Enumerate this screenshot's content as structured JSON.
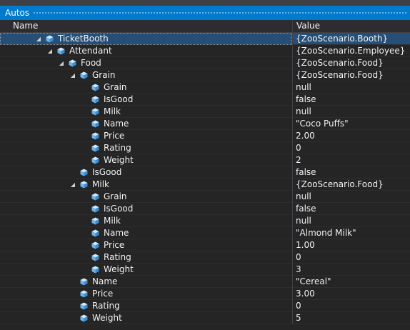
{
  "window": {
    "title": "Autos"
  },
  "columns": {
    "name": "Name",
    "value": "Value"
  },
  "colors": {
    "title_bar": "#007acc",
    "background": "#252526",
    "header": "#2d2d30",
    "selection": "#264f78",
    "cube_icon": "#6fb3e6"
  },
  "rows": [
    {
      "name": "TicketBooth",
      "value": "{ZooScenario.Booth}",
      "depth": 0,
      "expandable": true,
      "expanded": true,
      "icon": "object-cube-icon",
      "selected": true
    },
    {
      "name": "Attendant",
      "value": "{ZooScenario.Employee}",
      "depth": 1,
      "expandable": true,
      "expanded": true,
      "icon": "object-cube-icon"
    },
    {
      "name": "Food",
      "value": "{ZooScenario.Food}",
      "depth": 2,
      "expandable": true,
      "expanded": true,
      "icon": "object-cube-icon"
    },
    {
      "name": "Grain",
      "value": "{ZooScenario.Food}",
      "depth": 3,
      "expandable": true,
      "expanded": true,
      "icon": "object-cube-icon"
    },
    {
      "name": "Grain",
      "value": "null",
      "depth": 4,
      "expandable": false,
      "icon": "property-cube-icon"
    },
    {
      "name": "IsGood",
      "value": "false",
      "depth": 4,
      "expandable": false,
      "icon": "property-cube-icon"
    },
    {
      "name": "Milk",
      "value": "null",
      "depth": 4,
      "expandable": false,
      "icon": "property-cube-icon"
    },
    {
      "name": "Name",
      "value": "\"Coco Puffs\"",
      "depth": 4,
      "expandable": false,
      "icon": "property-cube-icon"
    },
    {
      "name": "Price",
      "value": "2.00",
      "depth": 4,
      "expandable": false,
      "icon": "property-cube-icon"
    },
    {
      "name": "Rating",
      "value": "0",
      "depth": 4,
      "expandable": false,
      "icon": "property-cube-icon"
    },
    {
      "name": "Weight",
      "value": "2",
      "depth": 4,
      "expandable": false,
      "icon": "property-cube-icon"
    },
    {
      "name": "IsGood",
      "value": "false",
      "depth": 3,
      "expandable": false,
      "icon": "property-cube-icon"
    },
    {
      "name": "Milk",
      "value": "{ZooScenario.Food}",
      "depth": 3,
      "expandable": true,
      "expanded": true,
      "icon": "object-cube-icon"
    },
    {
      "name": "Grain",
      "value": "null",
      "depth": 4,
      "expandable": false,
      "icon": "property-cube-icon"
    },
    {
      "name": "IsGood",
      "value": "false",
      "depth": 4,
      "expandable": false,
      "icon": "property-cube-icon"
    },
    {
      "name": "Milk",
      "value": "null",
      "depth": 4,
      "expandable": false,
      "icon": "property-cube-icon"
    },
    {
      "name": "Name",
      "value": "\"Almond Milk\"",
      "depth": 4,
      "expandable": false,
      "icon": "property-cube-icon"
    },
    {
      "name": "Price",
      "value": "1.00",
      "depth": 4,
      "expandable": false,
      "icon": "property-cube-icon"
    },
    {
      "name": "Rating",
      "value": "0",
      "depth": 4,
      "expandable": false,
      "icon": "property-cube-icon"
    },
    {
      "name": "Weight",
      "value": "3",
      "depth": 4,
      "expandable": false,
      "icon": "property-cube-icon"
    },
    {
      "name": "Name",
      "value": "\"Cereal\"",
      "depth": 3,
      "expandable": false,
      "icon": "property-cube-icon"
    },
    {
      "name": "Price",
      "value": "3.00",
      "depth": 3,
      "expandable": false,
      "icon": "property-cube-icon"
    },
    {
      "name": "Rating",
      "value": "0",
      "depth": 3,
      "expandable": false,
      "icon": "property-cube-icon"
    },
    {
      "name": "Weight",
      "value": "5",
      "depth": 3,
      "expandable": false,
      "icon": "property-cube-icon"
    }
  ]
}
